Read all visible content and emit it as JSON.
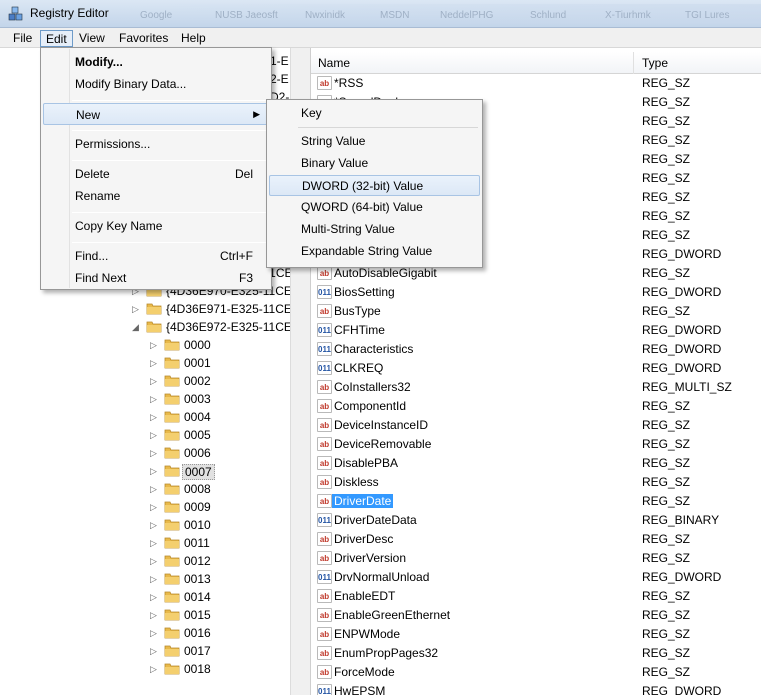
{
  "window": {
    "title": "Registry Editor"
  },
  "ghost_tabs": [
    "Google",
    "NUSB Jaeosft",
    "Nwxinidk",
    "MSDN",
    "NeddelPHG",
    "Schlund",
    "X-Tiurhmk",
    "TGI Lures"
  ],
  "menubar": [
    "File",
    "Edit",
    "View",
    "Favorites",
    "Help"
  ],
  "tree": {
    "top_keys": [
      "{4D36E96F-E325-11CE-I",
      "{4D36E970-E325-11CE-I",
      "{4D36E971-E325-11CE-I",
      "{4D36E972-E325-11CE-I"
    ],
    "partial_keys": [
      "1-E",
      "2-E",
      "D2-"
    ],
    "subkeys": [
      "0000",
      "0001",
      "0002",
      "0003",
      "0004",
      "0005",
      "0006",
      "0007",
      "0008",
      "0009",
      "0010",
      "0011",
      "0012",
      "0013",
      "0014",
      "0015",
      "0016",
      "0017",
      "0018"
    ],
    "selected": "0007"
  },
  "list": {
    "columns": {
      "name": "Name",
      "type": "Type"
    },
    "rows": [
      {
        "name": "*RSS",
        "type": "REG_SZ",
        "kind": "sz"
      },
      {
        "name": "*SpeedDuplex",
        "type": "REG_SZ",
        "kind": "sz"
      },
      {
        "name": "",
        "type": "REG_SZ",
        "kind": "sz"
      },
      {
        "name": "",
        "type": "REG_SZ",
        "kind": "sz"
      },
      {
        "name": "",
        "type": "REG_SZ",
        "kind": "sz"
      },
      {
        "name": "",
        "type": "REG_SZ",
        "kind": "sz"
      },
      {
        "name": "",
        "type": "REG_SZ",
        "kind": "sz"
      },
      {
        "name": "",
        "type": "REG_SZ",
        "kind": "sz"
      },
      {
        "name": "",
        "type": "REG_SZ",
        "kind": "sz"
      },
      {
        "name": "",
        "type": "REG_DWORD",
        "kind": "bin"
      },
      {
        "name": "AutoDisableGigabit",
        "type": "REG_SZ",
        "kind": "sz"
      },
      {
        "name": "BiosSetting",
        "type": "REG_DWORD",
        "kind": "bin"
      },
      {
        "name": "BusType",
        "type": "REG_SZ",
        "kind": "sz"
      },
      {
        "name": "CFHTime",
        "type": "REG_DWORD",
        "kind": "bin"
      },
      {
        "name": "Characteristics",
        "type": "REG_DWORD",
        "kind": "bin"
      },
      {
        "name": "CLKREQ",
        "type": "REG_DWORD",
        "kind": "bin"
      },
      {
        "name": "CoInstallers32",
        "type": "REG_MULTI_SZ",
        "kind": "sz"
      },
      {
        "name": "ComponentId",
        "type": "REG_SZ",
        "kind": "sz"
      },
      {
        "name": "DeviceInstanceID",
        "type": "REG_SZ",
        "kind": "sz"
      },
      {
        "name": "DeviceRemovable",
        "type": "REG_SZ",
        "kind": "sz"
      },
      {
        "name": "DisablePBA",
        "type": "REG_SZ",
        "kind": "sz"
      },
      {
        "name": "Diskless",
        "type": "REG_SZ",
        "kind": "sz"
      },
      {
        "name": "DriverDate",
        "type": "REG_SZ",
        "kind": "sz"
      },
      {
        "name": "DriverDateData",
        "type": "REG_BINARY",
        "kind": "bin"
      },
      {
        "name": "DriverDesc",
        "type": "REG_SZ",
        "kind": "sz"
      },
      {
        "name": "DriverVersion",
        "type": "REG_SZ",
        "kind": "sz"
      },
      {
        "name": "DrvNormalUnload",
        "type": "REG_DWORD",
        "kind": "bin"
      },
      {
        "name": "EnableEDT",
        "type": "REG_SZ",
        "kind": "sz"
      },
      {
        "name": "EnableGreenEthernet",
        "type": "REG_SZ",
        "kind": "sz"
      },
      {
        "name": "ENPWMode",
        "type": "REG_SZ",
        "kind": "sz"
      },
      {
        "name": "EnumPropPages32",
        "type": "REG_SZ",
        "kind": "sz"
      },
      {
        "name": "ForceMode",
        "type": "REG_SZ",
        "kind": "sz"
      },
      {
        "name": "HwEPSM",
        "type": "REG_DWORD",
        "kind": "bin"
      }
    ],
    "selected_row": "DriverDate"
  },
  "edit_menu": {
    "items": [
      {
        "label": "Modify...",
        "shortcut": "",
        "bold": true
      },
      {
        "label": "Modify Binary Data...",
        "shortcut": ""
      },
      {
        "label": "New",
        "shortcut": "",
        "submenu": true
      },
      {
        "label": "Permissions...",
        "shortcut": ""
      },
      {
        "label": "Delete",
        "shortcut": "Del"
      },
      {
        "label": "Rename",
        "shortcut": ""
      },
      {
        "label": "Copy Key Name",
        "shortcut": ""
      },
      {
        "label": "Find...",
        "shortcut": "Ctrl+F"
      },
      {
        "label": "Find Next",
        "shortcut": "F3"
      }
    ]
  },
  "new_submenu": {
    "items": [
      "Key",
      "String Value",
      "Binary Value",
      "DWORD (32-bit) Value",
      "QWORD (64-bit) Value",
      "Multi-String Value",
      "Expandable String Value"
    ],
    "highlighted": "DWORD (32-bit) Value"
  },
  "icons": {
    "string_value": "ab",
    "binary_value": "011"
  },
  "colors": {
    "selection": "#3399ff",
    "menu_highlight_border": "#a8c4e4",
    "folder": "#e8b94a"
  }
}
